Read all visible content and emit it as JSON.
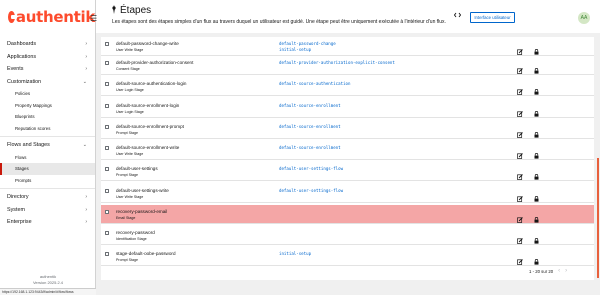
{
  "brand": {
    "logo_text": "authentik"
  },
  "sidebar": {
    "groups": [
      {
        "label": "Dashboards"
      },
      {
        "label": "Applications"
      },
      {
        "label": "Events"
      },
      {
        "label": "Customization"
      },
      {
        "label": "Flows and Stages"
      },
      {
        "label": "Directory"
      },
      {
        "label": "System"
      },
      {
        "label": "Enterprise"
      }
    ],
    "customization_items": [
      "Policies",
      "Property Mappings",
      "Blueprints",
      "Reputation scores"
    ],
    "flows_items": [
      "Flows",
      "Stages",
      "Prompts"
    ],
    "footer_line1": "authentik",
    "footer_line2": "Version 2025.2.4",
    "status_url": "https://192.168.1.123:9443/if/admin/#/flow/flows"
  },
  "header": {
    "title": "Étapes",
    "description": "Les étapes sont des étapes simples d'un flux au travers duquel un utilisateur est guidé. Une étape peut être uniquement exécutée à l'intérieur d'un flux.",
    "notification_count": "0",
    "user_interface_label": "Interface utilisateur",
    "avatar_initials": "AA",
    "icons": [
      "code-icon",
      "bell-icon",
      "gear-icon",
      "logout-icon"
    ]
  },
  "stages": [
    {
      "name": "default-password-change-write",
      "type": "User Write Stage",
      "flows": [
        "default-password-change",
        "initial-setup"
      ],
      "highlight": false
    },
    {
      "name": "default-provider-authorization-consent",
      "type": "Consent Stage",
      "flows": [
        "default-provider-authorization-explicit-consent"
      ],
      "highlight": false
    },
    {
      "name": "default-source-authentication-login",
      "type": "User Login Stage",
      "flows": [
        "default-source-authentication"
      ],
      "highlight": false
    },
    {
      "name": "default-source-enrollment-login",
      "type": "User Login Stage",
      "flows": [
        "default-source-enrollment"
      ],
      "highlight": false
    },
    {
      "name": "default-source-enrollment-prompt",
      "type": "Prompt Stage",
      "flows": [
        "default-source-enrollment"
      ],
      "highlight": false
    },
    {
      "name": "default-source-enrollment-write",
      "type": "User Write Stage",
      "flows": [
        "default-source-enrollment"
      ],
      "highlight": false
    },
    {
      "name": "default-user-settings",
      "type": "Prompt Stage",
      "flows": [
        "default-user-settings-flow"
      ],
      "highlight": false
    },
    {
      "name": "default-user-settings-write",
      "type": "User Write Stage",
      "flows": [
        "default-user-settings-flow"
      ],
      "highlight": false
    },
    {
      "name": "recovery-password-email",
      "type": "Email Stage",
      "flows": [],
      "highlight": true
    },
    {
      "name": "recovery-password",
      "type": "Identification Stage",
      "flows": [],
      "highlight": false
    },
    {
      "name": "stage-default-oobe-password",
      "type": "Prompt Stage",
      "flows": [
        "initial-setup"
      ],
      "highlight": false
    }
  ],
  "pagination": {
    "range": "1 - 20 sur 20",
    "prev": "‹",
    "next": "›"
  },
  "colors": {
    "brand": "#fd4b2d",
    "link": "#0066cc",
    "highlight_row": "#f4a6a6",
    "active_nav_border": "#c9190b"
  }
}
